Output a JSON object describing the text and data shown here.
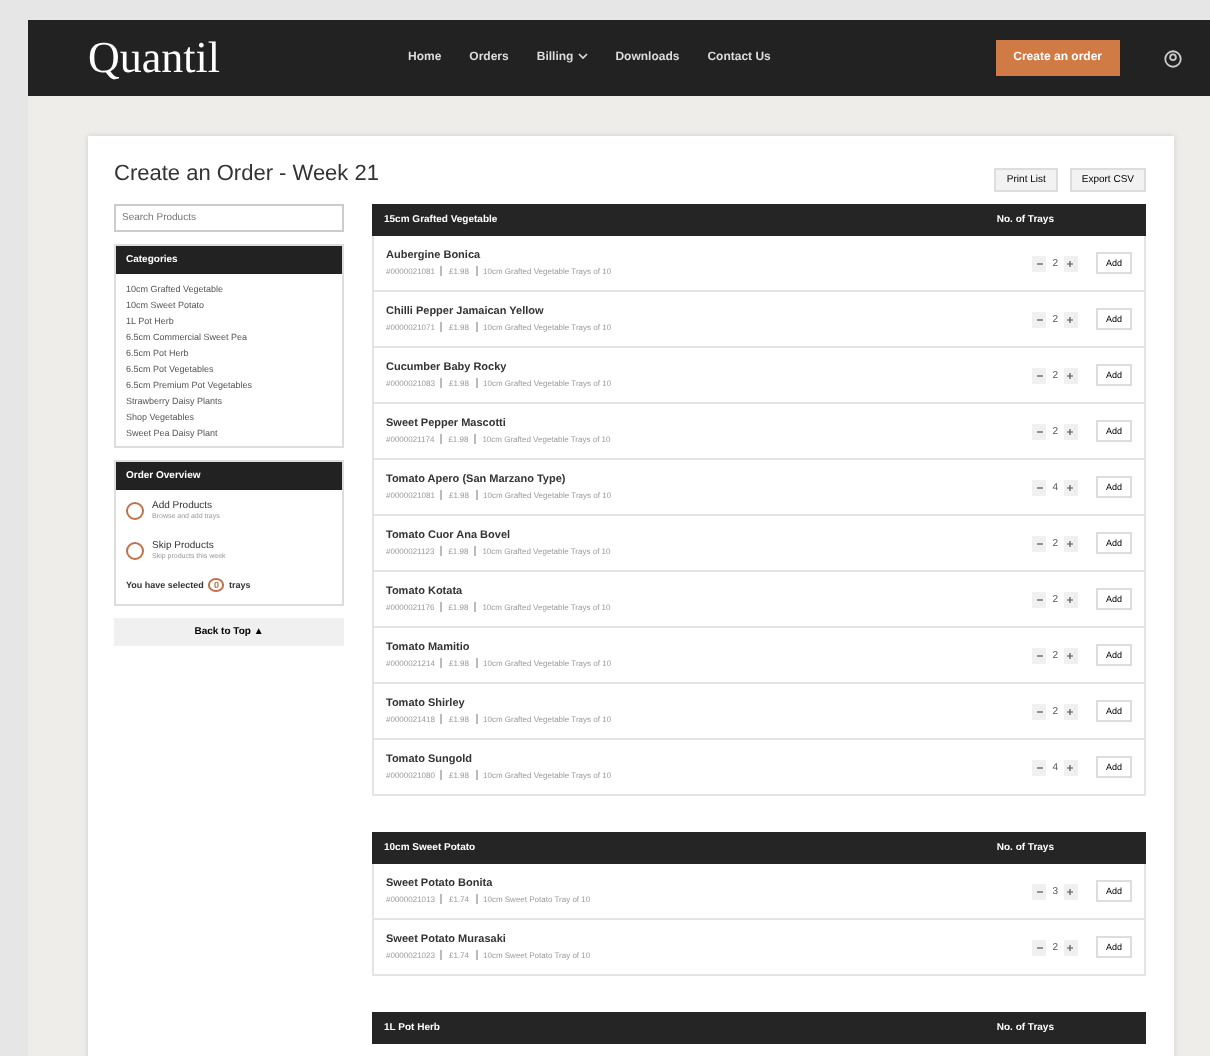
{
  "nav": {
    "logo": "Quantil",
    "links": [
      {
        "label": "Home"
      },
      {
        "label": "Orders"
      },
      {
        "label": "Billing",
        "caret": true
      },
      {
        "label": "Downloads"
      },
      {
        "label": "Contact Us"
      }
    ],
    "cta": "Create an order"
  },
  "page": {
    "title": "Create an Order - Week 21",
    "actions": [
      "Print List",
      "Export CSV"
    ]
  },
  "sidebar": {
    "search": {
      "placeholder": "Search Products"
    },
    "categories": {
      "title": "Categories",
      "items": [
        "10cm Grafted Vegetable",
        "10cm Sweet Potato",
        "1L Pot Herb",
        "6.5cm Commercial Sweet Pea",
        "6.5cm Pot Herb",
        "6.5cm Pot Vegetables",
        "6.5cm Premium Pot Vegetables",
        "Strawberry Daisy Plants",
        "Shop Vegetables",
        "Sweet Pea Daisy Plant"
      ]
    },
    "overview": {
      "title": "Order Overview",
      "items": [
        {
          "name": "Add Products",
          "sub": "Browse and add trays"
        },
        {
          "name": "Skip Products",
          "sub": "Skip products this week"
        }
      ],
      "selected_prefix": "You have selected",
      "count": "0",
      "selected_suffix": "trays"
    },
    "back": "Back to Top ▲"
  },
  "sections": [
    {
      "title": "15cm Grafted Vegetable",
      "qty_heading": "No. of Trays",
      "rows": [
        {
          "name": "Aubergine Bonica",
          "code": "#0000021081",
          "price": "£1.98",
          "desc": "10cm Grafted Vegetable Trays of 10",
          "qty": "2",
          "add": "Add"
        },
        {
          "name": "Chilli Pepper Jamaican Yellow",
          "code": "#0000021071",
          "price": "£1.98",
          "desc": "10cm Grafted Vegetable Trays of 10",
          "qty": "2",
          "add": "Add"
        },
        {
          "name": "Cucumber Baby Rocky",
          "code": "#0000021083",
          "price": "£1.98",
          "desc": "10cm Grafted Vegetable Trays of 10",
          "qty": "2",
          "add": "Add"
        },
        {
          "name": "Sweet Pepper Mascotti",
          "code": "#0000021174",
          "price": "£1.98",
          "desc": "10cm Grafted Vegetable Trays of 10",
          "qty": "2",
          "add": "Add"
        },
        {
          "name": "Tomato Apero (San Marzano Type)",
          "code": "#0000021081",
          "price": "£1.98",
          "desc": "10cm Grafted Vegetable Trays of 10",
          "qty": "4",
          "add": "Add"
        },
        {
          "name": "Tomato Cuor Ana Bovel",
          "code": "#0000021123",
          "price": "£1.98",
          "desc": "10cm Grafted Vegetable Trays of 10",
          "qty": "2",
          "add": "Add"
        },
        {
          "name": "Tomato Kotata",
          "code": "#0000021176",
          "price": "£1.98",
          "desc": "10cm Grafted Vegetable Trays of 10",
          "qty": "2",
          "add": "Add"
        },
        {
          "name": "Tomato Mamitio",
          "code": "#0000021214",
          "price": "£1.98",
          "desc": "10cm Grafted Vegetable Trays of 10",
          "qty": "2",
          "add": "Add"
        },
        {
          "name": "Tomato Shirley",
          "code": "#0000021418",
          "price": "£1.98",
          "desc": "10cm Grafted Vegetable Trays of 10",
          "qty": "2",
          "add": "Add"
        },
        {
          "name": "Tomato Sungold",
          "code": "#0000021080",
          "price": "£1.98",
          "desc": "10cm Grafted Vegetable Trays of 10",
          "qty": "4",
          "add": "Add"
        }
      ]
    },
    {
      "title": "10cm Sweet Potato",
      "qty_heading": "No. of Trays",
      "rows": [
        {
          "name": "Sweet Potato Bonita",
          "code": "#0000021013",
          "price": "£1.74",
          "desc": "10cm Sweet Potato Tray of 10",
          "qty": "3",
          "add": "Add"
        },
        {
          "name": "Sweet Potato Murasaki",
          "code": "#0000021023",
          "price": "£1.74",
          "desc": "10cm Sweet Potato Tray of 10",
          "qty": "2",
          "add": "Add"
        }
      ]
    },
    {
      "title": "1L Pot Herb",
      "qty_heading": "No. of Trays"
    }
  ]
}
